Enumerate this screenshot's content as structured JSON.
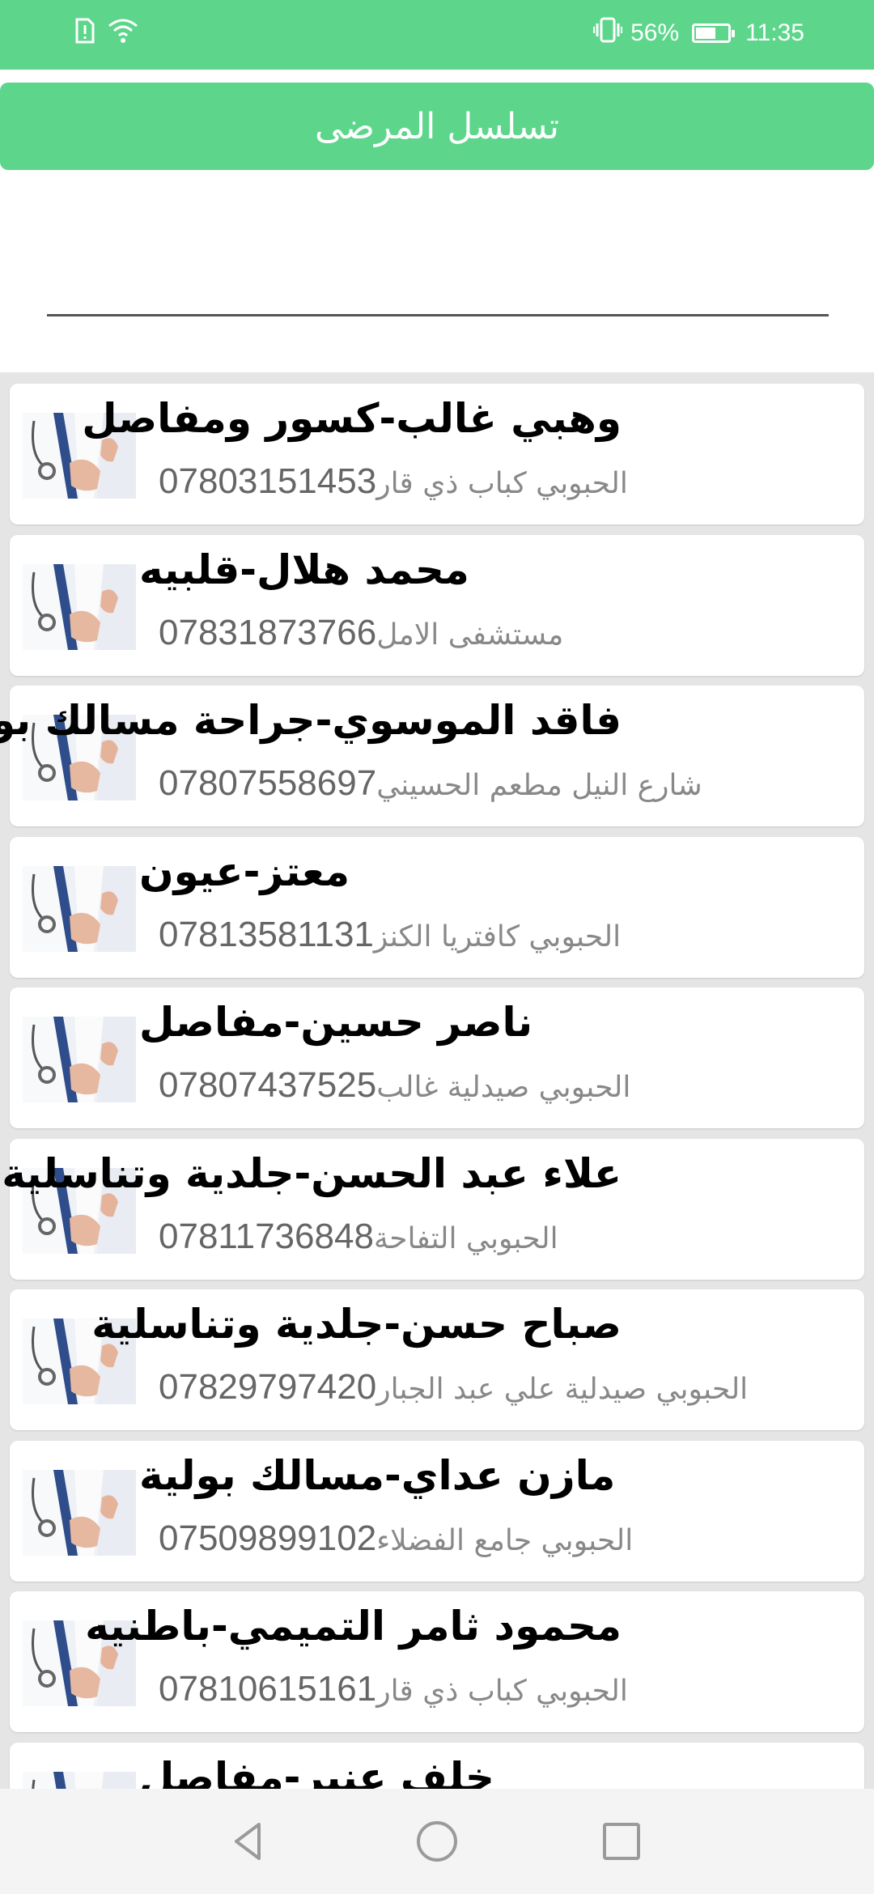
{
  "status_bar": {
    "battery": "56%",
    "time": "11:35",
    "icons": [
      "sim-alert-icon",
      "wifi-icon",
      "vibrate-icon",
      "battery-icon"
    ]
  },
  "header": {
    "title": "تسلسل المرضى"
  },
  "search": {
    "value": "",
    "placeholder": ""
  },
  "doctors": [
    {
      "name": "وهبي غالب-كسور ومفاصل",
      "address": "الحبوبي كباب ذي قار",
      "phone": "07803151453"
    },
    {
      "name": "محمد هلال-قلبيه",
      "address": "مستشفى الامل",
      "phone": "07831873766"
    },
    {
      "name": "فاقد الموسوي-جراحة مسالك بولية",
      "address": "شارع النيل مطعم الحسيني",
      "phone": "07807558697"
    },
    {
      "name": "معتز-عيون",
      "address": "الحبوبي كافتريا الكنز",
      "phone": "07813581131"
    },
    {
      "name": "ناصر حسين-مفاصل",
      "address": "الحبوبي صيدلية غالب",
      "phone": "07807437525"
    },
    {
      "name": "علاء عبد الحسن-جلدية وتناسلية",
      "address": "الحبوبي التفاحة",
      "phone": "07811736848"
    },
    {
      "name": "صباح حسن-جلدية وتناسلية",
      "address": "الحبوبي صيدلية علي عبد الجبار",
      "phone": "07829797420"
    },
    {
      "name": "مازن عداي-مسالك بولية",
      "address": "الحبوبي جامع الفضلاء",
      "phone": "07509899102"
    },
    {
      "name": "محمود ثامر التميمي-باطنيه",
      "address": "الحبوبي كباب ذي قار",
      "phone": "07810615161"
    },
    {
      "name": "خلف عنبر-مفاصل",
      "address": "",
      "phone": ""
    }
  ],
  "nav": {
    "buttons": [
      "back-icon",
      "home-icon",
      "recents-icon"
    ]
  },
  "colors": {
    "accent": "#5dd68c",
    "list_background": "#e5e5e5",
    "secondary_text": "#777777"
  }
}
